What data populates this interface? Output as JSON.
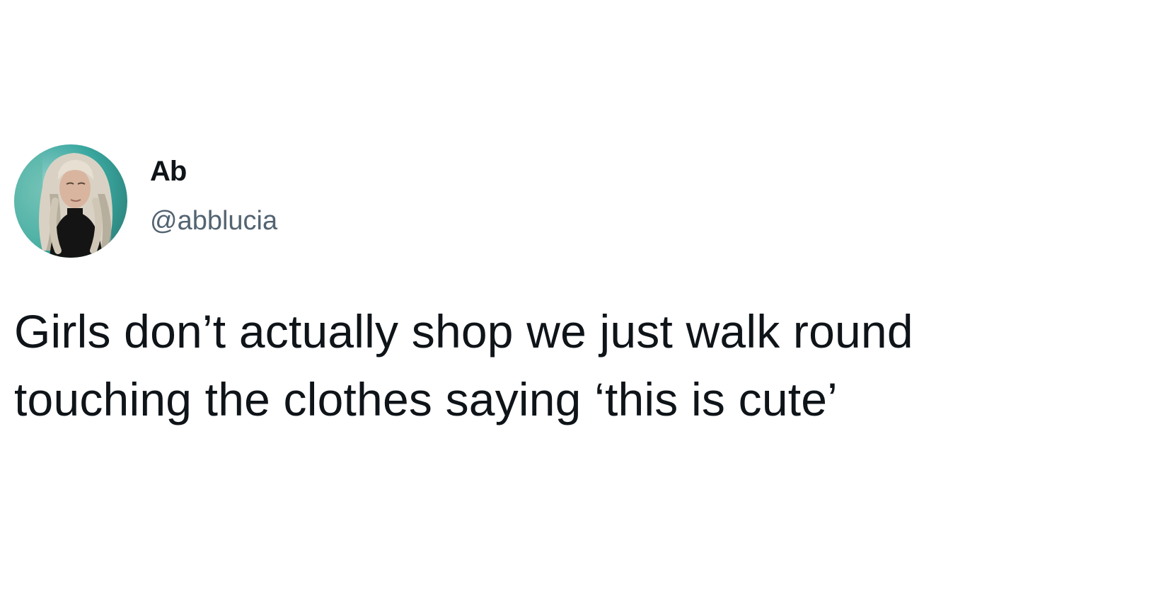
{
  "author": {
    "display_name": "Ab",
    "handle": "@abblucia",
    "avatar": {
      "icon": "profile-photo",
      "colors": {
        "background": "#3aa8a0",
        "background_light": "#9fd6cf",
        "hair": "#d9d2c4",
        "hair_shadow": "#a89f8e",
        "face": "#d9b5a0",
        "top": "#141414"
      }
    }
  },
  "tweet": {
    "text_lines": [
      "Girls don’t actually shop we just walk round",
      "touching the clothes saying ‘this is cute’"
    ]
  },
  "colors": {
    "text_primary": "#0f1419",
    "text_secondary": "#536471",
    "background": "#ffffff"
  }
}
